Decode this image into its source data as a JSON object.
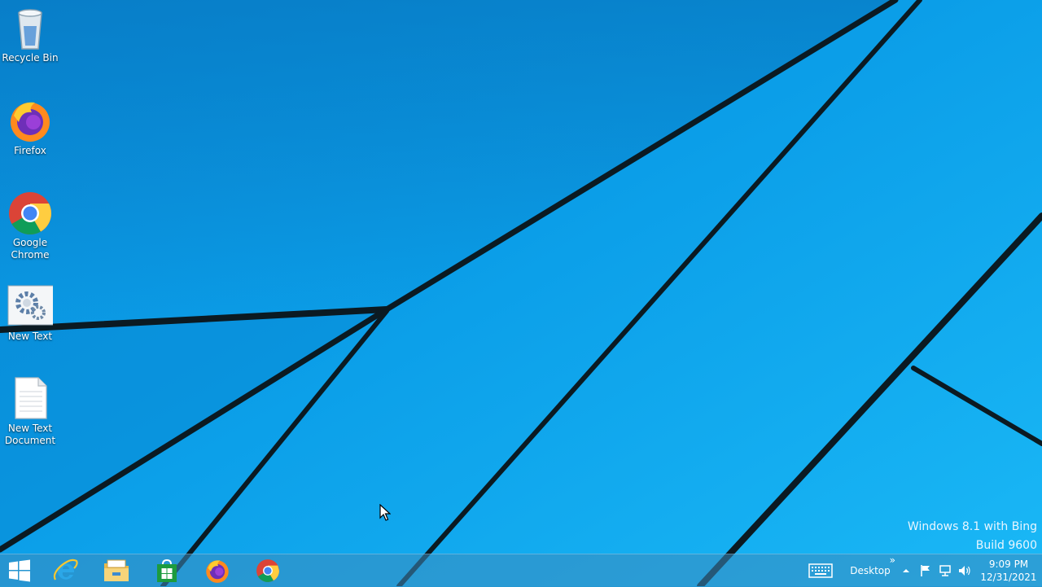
{
  "desktop": {
    "icons": [
      {
        "label": "Recycle Bin",
        "icon": "recycle-bin-icon"
      },
      {
        "label": "Firefox",
        "icon": "firefox-icon"
      },
      {
        "label": "Google Chrome",
        "icon": "chrome-icon"
      },
      {
        "label": "New Text",
        "icon": "settings-shortcut-icon"
      },
      {
        "label": "New Text Document",
        "icon": "text-document-icon"
      }
    ],
    "watermark": {
      "line1": "Windows 8.1 with Bing",
      "line2": "Build 9600"
    }
  },
  "taskbar": {
    "pinned": [
      {
        "icon": "start-icon"
      },
      {
        "icon": "internet-explorer-icon"
      },
      {
        "icon": "file-explorer-icon"
      },
      {
        "icon": "store-icon"
      },
      {
        "icon": "firefox-icon"
      },
      {
        "icon": "chrome-icon"
      }
    ],
    "desktop_toolbar_label": "Desktop",
    "overflow_glyph": "»",
    "clock": {
      "time": "9:09 PM",
      "date": "12/31/2021"
    }
  },
  "colors": {
    "wallpaper": "#0aa4ec",
    "taskbar": "#3c8cbe"
  }
}
